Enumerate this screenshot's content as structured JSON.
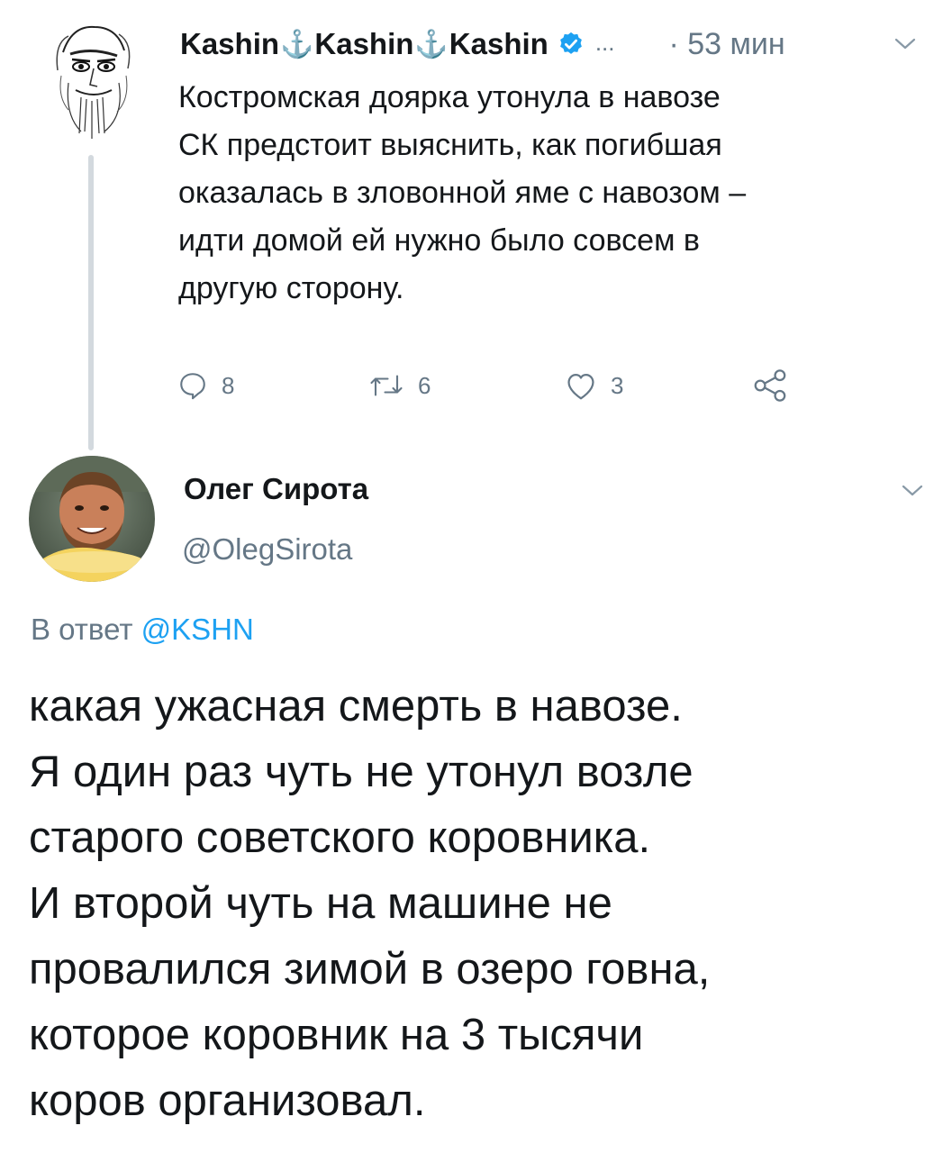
{
  "tweet1": {
    "name_part": "Kashin",
    "anchor_glyph": "⚓",
    "verified_icon": "verified-badge-icon",
    "ellipsis": "...",
    "timestamp": "· 53 мин",
    "lines": [
      "Костромская доярка утонула в навозе",
      "СК предстоит выяснить, как погибшая",
      "оказалась в зловонной яме с навозом –",
      "идти домой ей нужно было совсем в",
      "другую сторону."
    ],
    "actions": {
      "reply_count": "8",
      "retweet_count": "6",
      "like_count": "3"
    }
  },
  "tweet2": {
    "name": "Олег Сирота",
    "handle": "@OlegSirota",
    "reply_prefix": "В ответ",
    "reply_mention": "@KSHN",
    "lines": [
      "какая ужасная смерть в навозе.",
      "Я один раз чуть не утонул возле",
      "старого советского коровника.",
      "И второй чуть на машине не",
      "провалился зимой в озеро говна,",
      "которое коровник на 3 тысячи",
      "коров организовал."
    ]
  },
  "colors": {
    "text": "#14171a",
    "secondary": "#657786",
    "accent": "#1da1f2",
    "thread_line": "#d3d9de"
  }
}
